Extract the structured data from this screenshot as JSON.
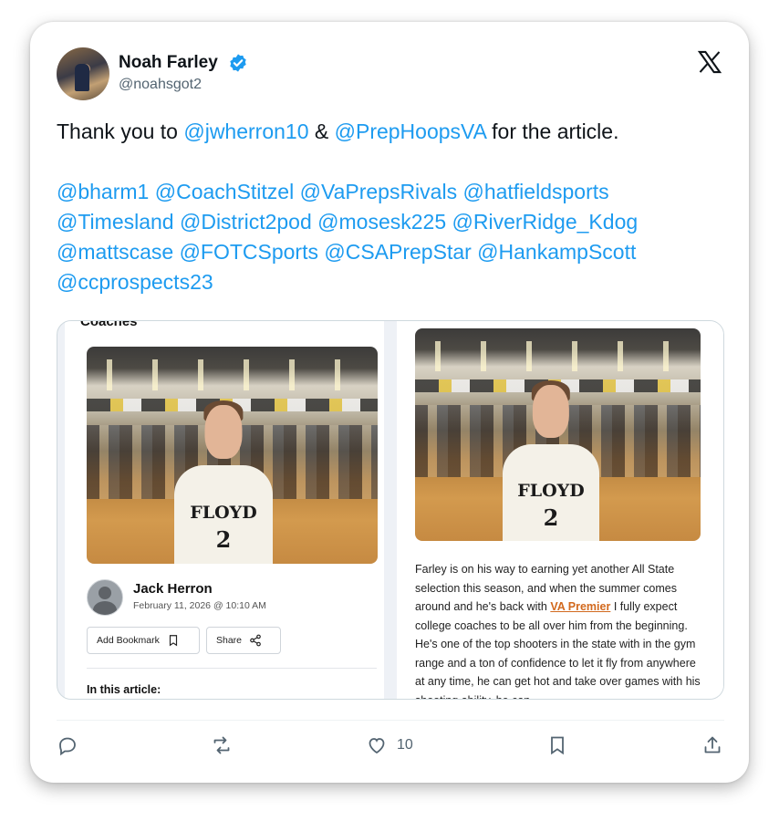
{
  "tweet": {
    "author_name": "Noah Farley",
    "author_handle": "@noahsgot2",
    "line1_prefix": "Thank you to ",
    "line1_mention1": "@jwherron10",
    "line1_amp": " & ",
    "line1_mention2": "@PrepHoopsVA",
    "line1_suffix": " for the article.",
    "mentions": [
      "@bharm1",
      "@CoachStitzel",
      "@VaPrepsRivals",
      "@hatfieldsports",
      "@Timesland",
      "@District2pod",
      "@mosesk225",
      "@RiverRidge_Kdog",
      "@mattscase",
      "@FOTCSports",
      "@CSAPrepStar",
      "@HankampScott",
      "@ccprospects23"
    ]
  },
  "media": {
    "left": {
      "section_heading": "Coaches",
      "jersey_text": "FLOYD",
      "jersey_number": "2",
      "author_name": "Jack Herron",
      "author_date": "February 11, 2026 @ 10:10 AM",
      "bookmark_label": "Add Bookmark",
      "share_label": "Share",
      "in_article_label": "In this article:"
    },
    "right": {
      "jersey_text": "FLOYD",
      "jersey_number": "2",
      "body_before_link": "Farley is on his way to earning yet another All State selection this season, and when the summer comes around and he's back with ",
      "link_text": "VA Premier",
      "body_after_link": " I fully expect college coaches to be all over him from the beginning. He's one of the top shooters in the state with in the gym range and a ton of confidence to let it fly from anywhere at any time, he can get hot and take over games with his shooting ability, he can"
    }
  },
  "actions": {
    "likes_count": "10"
  },
  "colors": {
    "mention": "#1d9bf0",
    "verified": "#1d9bf0",
    "link_orange": "#d2691e",
    "muted": "#536471"
  },
  "icons": [
    "verified-badge-icon",
    "x-logo-icon",
    "reply-icon",
    "retweet-icon",
    "like-icon",
    "bookmark-icon",
    "share-icon"
  ]
}
